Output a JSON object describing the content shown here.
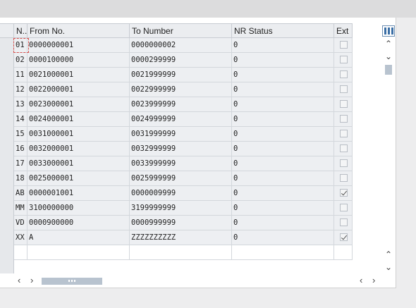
{
  "table": {
    "columns": [
      "N..",
      "From No.",
      "To Number",
      "NR Status",
      "Ext"
    ],
    "rows": [
      {
        "n": "01",
        "from": "0000000001",
        "to": "0000000002",
        "status": "0",
        "ext": false
      },
      {
        "n": "02",
        "from": "0000100000",
        "to": "0000299999",
        "status": "0",
        "ext": false
      },
      {
        "n": "11",
        "from": "0021000001",
        "to": "0021999999",
        "status": "0",
        "ext": false
      },
      {
        "n": "12",
        "from": "0022000001",
        "to": "0022999999",
        "status": "0",
        "ext": false
      },
      {
        "n": "13",
        "from": "0023000001",
        "to": "0023999999",
        "status": "0",
        "ext": false
      },
      {
        "n": "14",
        "from": "0024000001",
        "to": "0024999999",
        "status": "0",
        "ext": false
      },
      {
        "n": "15",
        "from": "0031000001",
        "to": "0031999999",
        "status": "0",
        "ext": false
      },
      {
        "n": "16",
        "from": "0032000001",
        "to": "0032999999",
        "status": "0",
        "ext": false
      },
      {
        "n": "17",
        "from": "0033000001",
        "to": "0033999999",
        "status": "0",
        "ext": false
      },
      {
        "n": "18",
        "from": "0025000001",
        "to": "0025999999",
        "status": "0",
        "ext": false
      },
      {
        "n": "AB",
        "from": "0000001001",
        "to": "0000009999",
        "status": "0",
        "ext": true
      },
      {
        "n": "MM",
        "from": "3100000000",
        "to": "3199999999",
        "status": "0",
        "ext": false
      },
      {
        "n": "VD",
        "from": "0000900000",
        "to": "0000999999",
        "status": "0",
        "ext": false
      },
      {
        "n": "XX",
        "from": "A",
        "to": "ZZZZZZZZZZ",
        "status": "0",
        "ext": true
      }
    ]
  },
  "icons": {
    "settings": "column-settings-icon",
    "scroll_up": "chevron-up-icon",
    "scroll_down": "chevron-down-icon",
    "scroll_left": "chevron-left-icon",
    "scroll_right": "chevron-right-icon"
  },
  "colors": {
    "header_bg": "#ebedf0",
    "cell_bg": "#edeff2",
    "focus": "#d9534f",
    "scroll_thumb": "#b8c3cf"
  }
}
